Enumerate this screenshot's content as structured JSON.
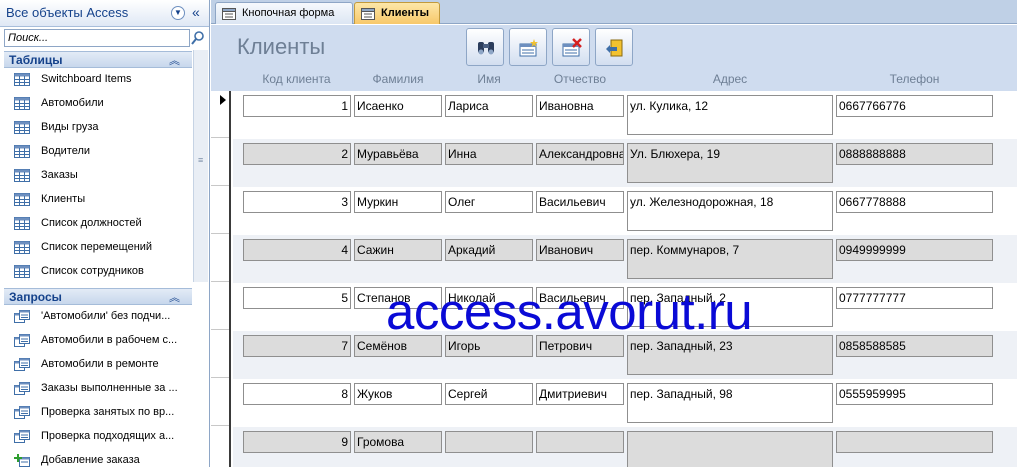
{
  "nav": {
    "title": "Все объекты Access",
    "search_placeholder": "Поиск...",
    "groups": [
      {
        "label": "Таблицы",
        "items": [
          {
            "label": "Switchboard Items",
            "icon": "table-icon"
          },
          {
            "label": "Автомобили",
            "icon": "table-icon"
          },
          {
            "label": "Виды груза",
            "icon": "table-icon"
          },
          {
            "label": "Водители",
            "icon": "table-icon"
          },
          {
            "label": "Заказы",
            "icon": "table-icon"
          },
          {
            "label": "Клиенты",
            "icon": "table-icon"
          },
          {
            "label": "Список должностей",
            "icon": "table-icon"
          },
          {
            "label": "Список перемещений",
            "icon": "table-icon"
          },
          {
            "label": "Список сотрудников",
            "icon": "table-icon"
          }
        ]
      },
      {
        "label": "Запросы",
        "items": [
          {
            "label": "'Автомобили' без подчи...",
            "icon": "query-icon"
          },
          {
            "label": "Автомобили в рабочем с...",
            "icon": "query-icon"
          },
          {
            "label": "Автомобили в ремонте",
            "icon": "query-icon"
          },
          {
            "label": "Заказы выполненные за ...",
            "icon": "query-icon"
          },
          {
            "label": "Проверка занятых по вр...",
            "icon": "query-icon"
          },
          {
            "label": "Проверка подходящих а...",
            "icon": "query-icon"
          },
          {
            "label": "Добавление заказа",
            "icon": "append-query-icon"
          }
        ]
      }
    ]
  },
  "tabs": [
    {
      "label": "Кнопочная форма",
      "active": false
    },
    {
      "label": "Клиенты",
      "active": true
    }
  ],
  "form": {
    "title": "Клиенты",
    "buttons": [
      {
        "name": "find-button",
        "icon": "binoculars-icon"
      },
      {
        "name": "new-record-button",
        "icon": "new-record-icon"
      },
      {
        "name": "delete-record-button",
        "icon": "delete-record-icon"
      },
      {
        "name": "close-form-button",
        "icon": "exit-door-icon"
      }
    ],
    "columns": [
      "Код клиента",
      "Фамилия",
      "Имя",
      "Отчество",
      "Адрес",
      "Телефон"
    ],
    "records": [
      {
        "id": "1",
        "last": "Исаенко",
        "first": "Лариса",
        "middle": "Ивановна",
        "address": "ул. Кулика, 12",
        "phone": "0667766776"
      },
      {
        "id": "2",
        "last": "Муравьёва",
        "first": "Инна",
        "middle": "Александровна",
        "address": "Ул. Блюхера, 19",
        "phone": "0888888888"
      },
      {
        "id": "3",
        "last": "Муркин",
        "first": "Олег",
        "middle": "Васильевич",
        "address": "ул. Железнодорожная, 18",
        "phone": "0667778888"
      },
      {
        "id": "4",
        "last": "Сажин",
        "first": "Аркадий",
        "middle": "Иванович",
        "address": "пер. Коммунаров, 7",
        "phone": "0949999999"
      },
      {
        "id": "5",
        "last": "Степанов",
        "first": "Николай",
        "middle": "Васильевич",
        "address": "пер. Западный, 2",
        "phone": "0777777777"
      },
      {
        "id": "7",
        "last": "Семёнов",
        "first": "Игорь",
        "middle": "Петрович",
        "address": "пер. Западный, 23",
        "phone": "0858588585"
      },
      {
        "id": "8",
        "last": "Жуков",
        "first": "Сергей",
        "middle": "Дмитриевич",
        "address": "пер. Западный, 98",
        "phone": "0555959995"
      },
      {
        "id": "9",
        "last": "Громова",
        "first": "",
        "middle": "",
        "address": "",
        "phone": ""
      }
    ]
  },
  "watermark": "access.avorut.ru"
}
